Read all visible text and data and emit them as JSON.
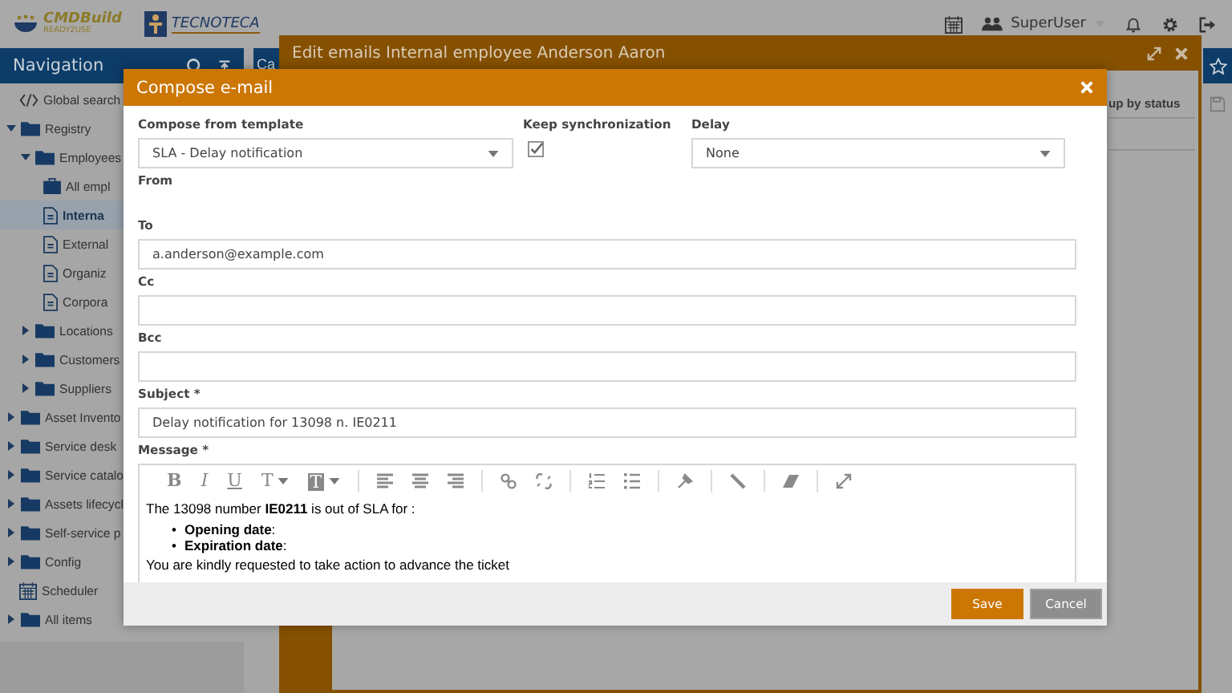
{
  "header": {
    "logos": [
      {
        "kind": "cmdbuild",
        "text": "CMDBuild",
        "subtext": "READY2USE"
      },
      {
        "kind": "tecnoteca",
        "text": "TECNOTECA"
      }
    ],
    "user": "SuperUser"
  },
  "navigation": {
    "title": "Navigation",
    "items": [
      {
        "label": "Global search",
        "kind": "link",
        "selected": false
      },
      {
        "label": "Registry",
        "kind": "folder",
        "expanded": true,
        "selected": false,
        "children": [
          {
            "label": "Employees",
            "kind": "folder",
            "expanded": true,
            "selected": false,
            "children": [
              {
                "label": "All empl",
                "kind": "superclass",
                "selected": false
              },
              {
                "label": "Interna",
                "kind": "class",
                "selected": true
              },
              {
                "label": "External",
                "kind": "class",
                "selected": false
              },
              {
                "label": "Organiz",
                "kind": "class",
                "selected": false
              },
              {
                "label": "Corpora",
                "kind": "class",
                "selected": false
              }
            ]
          },
          {
            "label": "Locations",
            "kind": "folder",
            "expanded": false,
            "selected": false
          },
          {
            "label": "Customers",
            "kind": "folder",
            "expanded": false,
            "selected": false
          },
          {
            "label": "Suppliers",
            "kind": "folder",
            "expanded": false,
            "selected": false
          }
        ]
      },
      {
        "label": "Asset Invento",
        "kind": "folder",
        "expanded": false,
        "selected": false
      },
      {
        "label": "Service desk",
        "kind": "folder",
        "expanded": false,
        "selected": false
      },
      {
        "label": "Service catalo",
        "kind": "folder",
        "expanded": false,
        "selected": false
      },
      {
        "label": "Assets lifecycl",
        "kind": "folder",
        "expanded": false,
        "selected": false
      },
      {
        "label": "Self-service p",
        "kind": "folder",
        "expanded": false,
        "selected": false
      },
      {
        "label": "Config",
        "kind": "folder",
        "expanded": false,
        "selected": false
      },
      {
        "label": "Scheduler",
        "kind": "calendar",
        "selected": false
      },
      {
        "label": "All items",
        "kind": "folder",
        "expanded": false,
        "selected": false
      }
    ]
  },
  "main_panel": {
    "title": "Ca"
  },
  "edit_window": {
    "title": "Edit emails Internal employee Anderson Aaron",
    "group_label": "up by status"
  },
  "compose_dialog": {
    "title": "Compose e-mail",
    "template": {
      "label": "Compose from template",
      "value": "SLA - Delay notification"
    },
    "keep_sync": {
      "label": "Keep synchronization",
      "checked": true
    },
    "delay": {
      "label": "Delay",
      "value": "None"
    },
    "from": {
      "label": "From"
    },
    "to": {
      "label": "To",
      "value": "a.anderson@example.com"
    },
    "cc": {
      "label": "Cc"
    },
    "bcc": {
      "label": "Bcc"
    },
    "subject": {
      "label": "Subject *",
      "value": "Delay notification for 13098 n. IE0211"
    },
    "message": {
      "label": "Message *",
      "toolbar": [
        [
          {
            "kind": "bold",
            "text": "B"
          },
          {
            "kind": "italic",
            "text": "I"
          },
          {
            "kind": "underline",
            "text": "U"
          },
          {
            "kind": "text-color",
            "text": "T"
          },
          {
            "kind": "background-color",
            "text": "T"
          }
        ],
        [
          {
            "kind": "align-left"
          },
          {
            "kind": "align-center"
          },
          {
            "kind": "align-right"
          }
        ],
        [
          {
            "kind": "link"
          },
          {
            "kind": "unlink"
          }
        ],
        [
          {
            "kind": "ordered-list"
          },
          {
            "kind": "bullet-list"
          }
        ],
        [
          {
            "kind": "brush"
          }
        ],
        [
          {
            "kind": "pencil"
          }
        ],
        [
          {
            "kind": "eraser"
          }
        ],
        [
          {
            "kind": "expand"
          }
        ]
      ],
      "paragraph": "The 13098 number **IE0211** is out of SLA for :",
      "bullets": [
        {
          "marker": "•",
          "text": "**Opening date**:"
        },
        {
          "marker": "•",
          "text": "**Expiration date**:"
        }
      ],
      "closing": "You are kindly requested to take action to advance the ticket"
    },
    "buttons": [
      {
        "kind": "primary",
        "label": "Save"
      },
      {
        "kind": "secondary",
        "label": "Cancel"
      }
    ]
  }
}
